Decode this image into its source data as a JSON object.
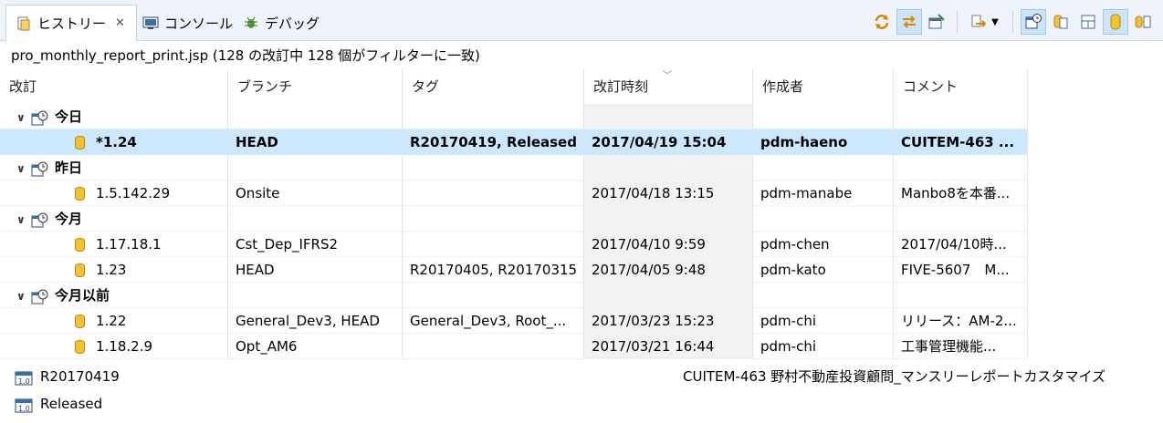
{
  "tabs": [
    {
      "label": "ヒストリー",
      "close": "✕",
      "icon": "history-icon"
    },
    {
      "label": "コンソール",
      "icon": "console-icon"
    },
    {
      "label": "デバッグ",
      "icon": "bug-icon"
    }
  ],
  "title_line": "pro_monthly_report_print.jsp (128 の改訂中 128 個がフィルターに一致)",
  "columns": [
    "改訂",
    "ブランチ",
    "タグ",
    "改訂時刻",
    "作成者",
    "コメント"
  ],
  "rows": [
    {
      "type": "group",
      "label": "今日"
    },
    {
      "type": "rev",
      "selected": true,
      "rev": "*1.24",
      "branch": "HEAD",
      "tags": "R20170419, Released",
      "date": "2017/04/19 15:04",
      "author": "pdm-haeno",
      "comment": "CUITEM-463 ..."
    },
    {
      "type": "group",
      "label": "昨日"
    },
    {
      "type": "rev",
      "rev": "1.5.142.29",
      "branch": "Onsite",
      "tags": "",
      "date": "2017/04/18 13:15",
      "author": "pdm-manabe",
      "comment": "Manbo8を本番..."
    },
    {
      "type": "group",
      "label": "今月"
    },
    {
      "type": "rev",
      "rev": "1.17.18.1",
      "branch": "Cst_Dep_IFRS2",
      "tags": "",
      "date": "2017/04/10 9:59",
      "author": "pdm-chen",
      "comment": "2017/04/10時..."
    },
    {
      "type": "rev",
      "rev": "1.23",
      "branch": "HEAD",
      "tags": "R20170405, R20170315",
      "date": "2017/04/05 9:48",
      "author": "pdm-kato",
      "comment": "FIVE-5607　M..."
    },
    {
      "type": "group",
      "label": "今月以前"
    },
    {
      "type": "rev",
      "rev": "1.22",
      "branch": "General_Dev3, HEAD",
      "tags": "General_Dev3, Root_...",
      "date": "2017/03/23 15:23",
      "author": "pdm-chi",
      "comment": "リリース：AM-2..."
    },
    {
      "type": "rev",
      "rev": "1.18.2.9",
      "branch": "Opt_AM6",
      "tags": "",
      "date": "2017/03/21 16:44",
      "author": "pdm-chi",
      "comment": "工事管理機能..."
    }
  ],
  "bottom_tags": [
    "R20170419",
    "Released"
  ],
  "bottom_comment": "CUITEM-463 野村不動産投資顧問_マンスリーレポートカスタマイズ",
  "colors": {
    "selection": "#cce8ff",
    "tabbar": "#eef3fa",
    "toggle_on": "#cce4f7"
  }
}
